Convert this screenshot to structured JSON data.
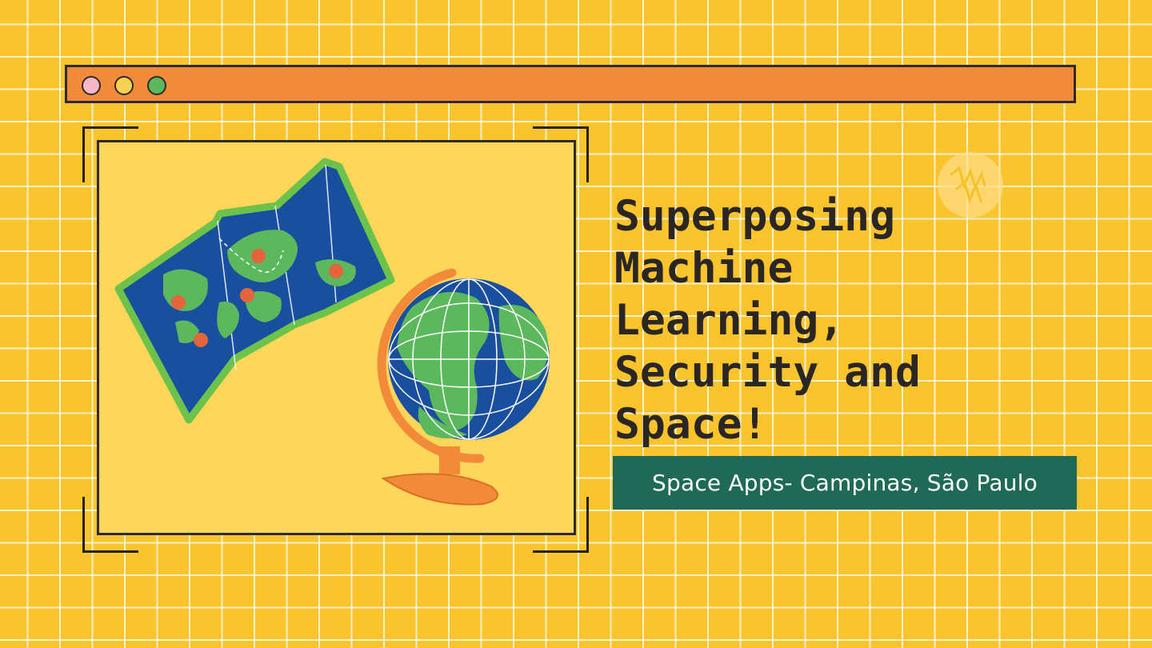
{
  "window": {
    "dots": [
      {
        "name": "close",
        "color": "#f7b7c7"
      },
      {
        "name": "minimize",
        "color": "#f9d152"
      },
      {
        "name": "maximize",
        "color": "#5cb85c"
      }
    ],
    "bar_color": "#f28a3a"
  },
  "illustration": {
    "items": [
      "folded-world-map",
      "desk-globe"
    ]
  },
  "headline": {
    "title": "Superposing\nMachine\nLearning,\nSecurity and\nSpace!"
  },
  "subtitle": {
    "label": "Space Apps- Campinas, São Paulo",
    "background": "#1f6a56"
  },
  "colors": {
    "background": "#fbc42c",
    "panel": "#fed659",
    "ocean": "#1a4fa0",
    "land": "#5cb85c",
    "pin": "#e4643c"
  }
}
